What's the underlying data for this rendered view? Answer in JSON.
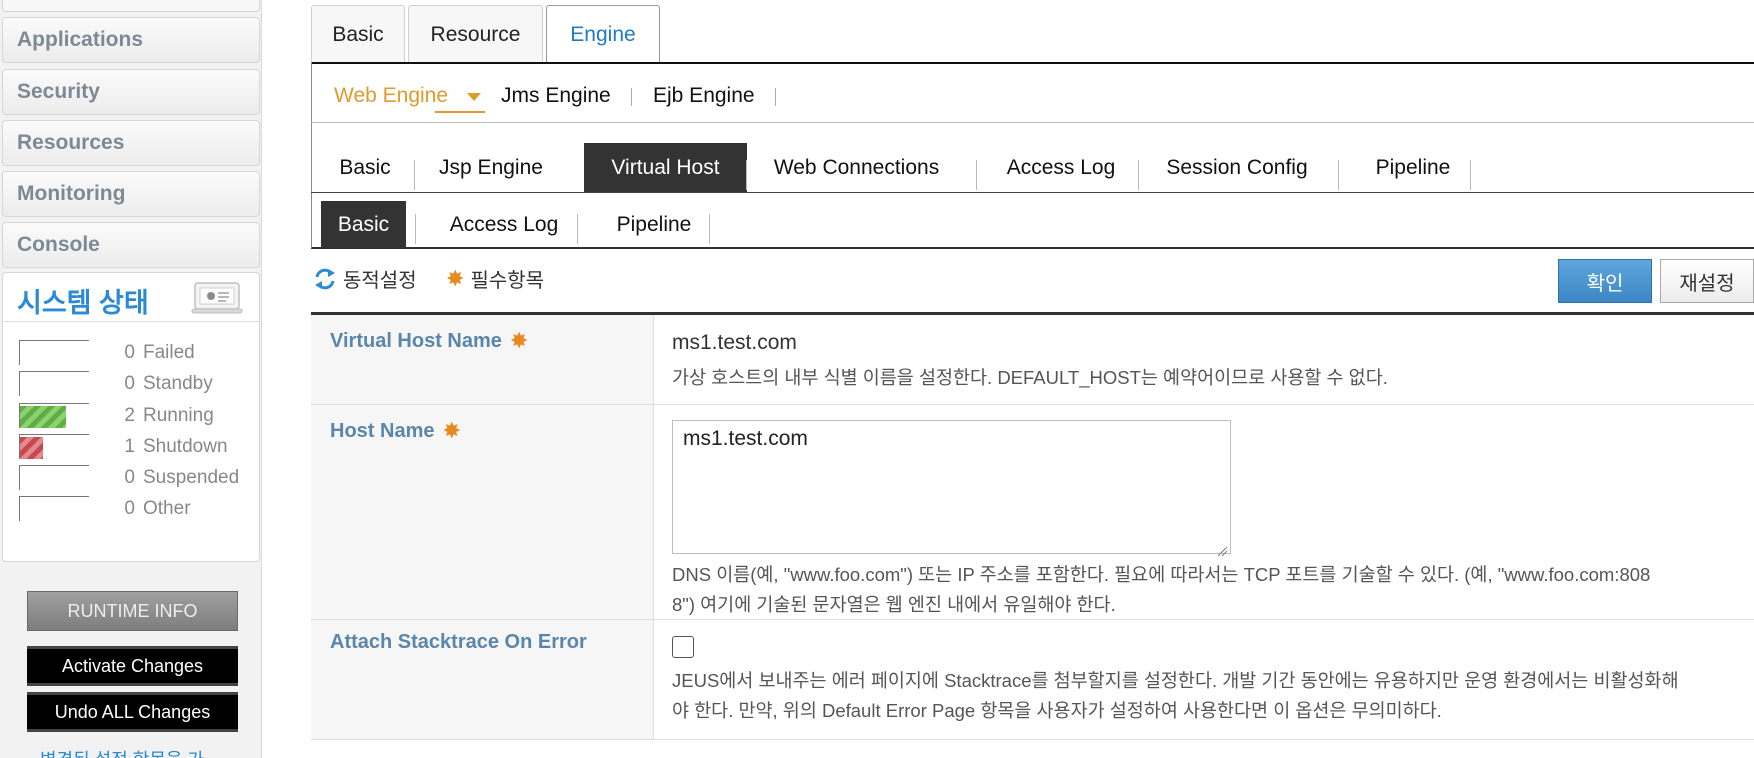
{
  "sidebar": {
    "nav_items": [
      {
        "label": "Applications"
      },
      {
        "label": "Security"
      },
      {
        "label": "Resources"
      },
      {
        "label": "Monitoring"
      },
      {
        "label": "Console"
      }
    ],
    "system_status": {
      "title": "시스템 상태",
      "rows": [
        {
          "count": "0",
          "label": "Failed",
          "fill": 0
        },
        {
          "count": "0",
          "label": "Standby",
          "fill": 0
        },
        {
          "count": "2",
          "label": "Running",
          "fill": 0.67
        },
        {
          "count": "1",
          "label": "Shutdown",
          "fill": 0.33
        },
        {
          "count": "0",
          "label": "Suspended",
          "fill": 0
        },
        {
          "count": "0",
          "label": "Other",
          "fill": 0
        }
      ]
    },
    "runtime_info": "RUNTIME INFO",
    "activate_changes": "Activate Changes",
    "undo_all_changes": "Undo ALL Changes",
    "cut_text": "변경된 설정 항목을 가"
  },
  "top_tabs": [
    {
      "label": "Basic"
    },
    {
      "label": "Resource"
    },
    {
      "label": "Engine",
      "active": true
    }
  ],
  "engine_tabs": [
    {
      "label": "Web Engine",
      "active": true
    },
    {
      "label": "Jms Engine"
    },
    {
      "label": "Ejb Engine"
    }
  ],
  "web_engine_tabs": [
    {
      "label": "Basic"
    },
    {
      "label": "Jsp Engine"
    },
    {
      "label": "Virtual Host",
      "active": true
    },
    {
      "label": "Web Connections"
    },
    {
      "label": "Access Log"
    },
    {
      "label": "Session Config"
    },
    {
      "label": "Pipeline"
    }
  ],
  "virtual_host_tabs": [
    {
      "label": "Basic",
      "active": true
    },
    {
      "label": "Access Log"
    },
    {
      "label": "Pipeline"
    }
  ],
  "legend": {
    "dynamic": "동적설정",
    "required": "필수항목"
  },
  "buttons": {
    "confirm": "확인",
    "reset": "재설정"
  },
  "form": {
    "virtual_host_name": {
      "label": "Virtual Host Name",
      "value": "ms1.test.com",
      "desc": "가상 호스트의 내부 식별 이름을 설정한다. DEFAULT_HOST는 예약어이므로 사용할 수 없다."
    },
    "host_name": {
      "label": "Host Name",
      "value": "ms1.test.com",
      "desc_line1": "DNS 이름(예, \"www.foo.com\") 또는 IP 주소를 포함한다. 필요에 따라서는 TCP 포트를 기술할 수 있다. (예, \"www.foo.com:808",
      "desc_line2": "8\") 여기에 기술된 문자열은 웹 엔진 내에서 유일해야 한다."
    },
    "attach_stacktrace": {
      "label": "Attach Stacktrace On Error",
      "checked": false,
      "desc_line1": "JEUS에서 보내주는 에러 페이지에 Stacktrace를 첨부할지를 설정한다. 개발 기간 동안에는 유용하지만 운영 환경에서는 비활성화해",
      "desc_line2": "야 한다. 만약, 위의 Default Error Page 항목을 사용자가 설정하여 사용한다면 이 옵션은 무의미하다."
    }
  }
}
